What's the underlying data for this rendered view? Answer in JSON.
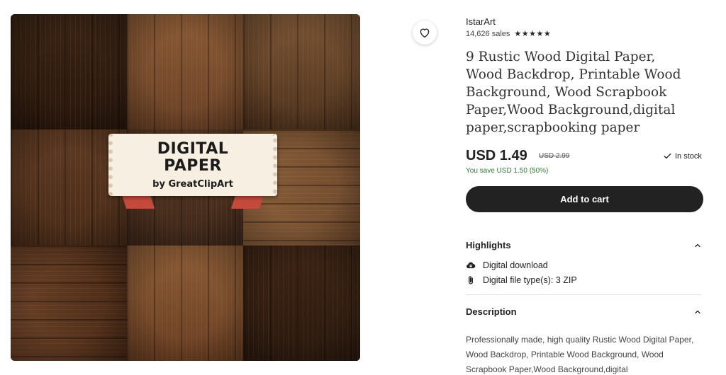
{
  "product_image": {
    "banner_title_line1": "DIGITAL",
    "banner_title_line2": "PAPER",
    "banner_subtitle": "by GreatClipArt"
  },
  "favorite_icon": "heart-outline-icon",
  "shop": {
    "name": "IstarArt",
    "sales": "14,626 sales",
    "stars": "★★★★★"
  },
  "listing": {
    "title": "9 Rustic Wood Digital Paper, Wood Backdrop, Printable Wood Background, Wood Scrapbook Paper,Wood Background,digital paper,scrapbooking paper",
    "price": "USD 1.49",
    "original_price": "USD 2.99",
    "savings": "You save USD 1.50 (50%)",
    "stock": "In stock",
    "add_to_cart": "Add to cart"
  },
  "highlights": {
    "heading": "Highlights",
    "items": [
      {
        "icon": "cloud-download-icon",
        "text": "Digital download"
      },
      {
        "icon": "paperclip-icon",
        "text": "Digital file type(s): 3 ZIP"
      }
    ]
  },
  "description": {
    "heading": "Description",
    "text": "Professionally made, high quality Rustic Wood Digital Paper, Wood Backdrop, Printable Wood Background, Wood Scrapbook Paper,Wood Background,digital"
  },
  "colors": {
    "button": "#222222",
    "savings": "#2f7a3a"
  }
}
